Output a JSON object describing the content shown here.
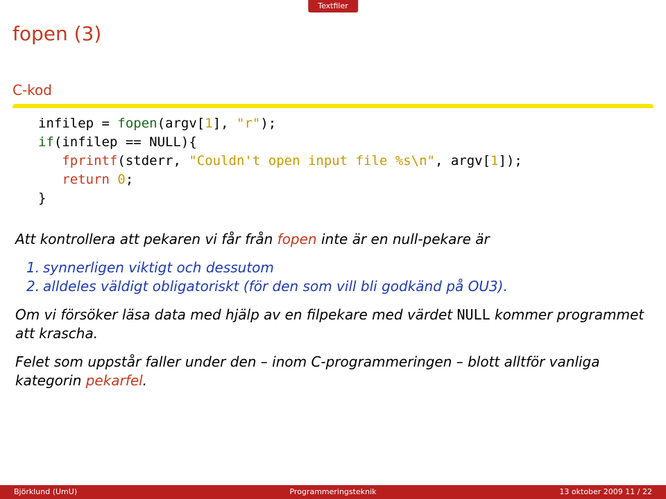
{
  "tab": "Textfiler",
  "title": "fopen (3)",
  "block_title": "C-kod",
  "code": {
    "l1a": "infilep = ",
    "l1_fn": "fopen",
    "l1b": "(argv[",
    "l1_num1": "1",
    "l1c": "], ",
    "l1_str": "\"r\"",
    "l1d": ");",
    "l2_if": "if",
    "l2a": "(infilep == NULL){",
    "l3_kw": "fprintf",
    "l3a": "(stderr, ",
    "l3_str": "\"Couldn't open input file %s\\n\"",
    "l3b": ", argv[",
    "l3_num": "1",
    "l3c": "]);",
    "l4_kw": "return",
    "l4_sp": " ",
    "l4_num": "0",
    "l4a": ";",
    "l5": "}"
  },
  "body": {
    "p1a": "Att kontrollera att pekaren vi får från ",
    "p1_accent": "fopen",
    "p1b": " inte är en null-pekare är",
    "li1_n": "1.",
    "li1": "synnerligen viktigt och dessutom",
    "li2_n": "2.",
    "li2": "alldeles väldigt obligatoriskt (för den som vill bli godkänd på OU3).",
    "p2a": "Om vi försöker läsa data med hjälp av en filpekare med värdet ",
    "p2_mono": "NULL",
    "p2b": " kommer programmet att krascha.",
    "p3a": "Felet som uppstår faller under den – inom C-programmeringen – blott alltför vanliga kategorin ",
    "p3_accent": "pekarfel",
    "p3b": "."
  },
  "footer": {
    "left": "Björklund (UmU)",
    "center": "Programmeringsteknik",
    "right": "13 oktober 2009    11 / 22"
  }
}
